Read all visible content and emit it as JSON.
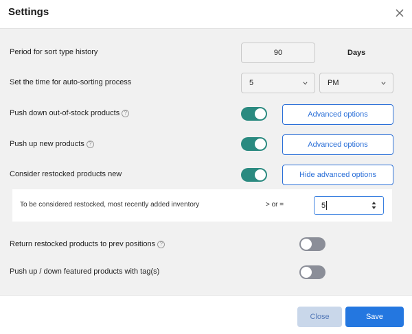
{
  "dialog": {
    "title": "Settings",
    "close_icon": "close-icon"
  },
  "settings": {
    "sort_history": {
      "label": "Period for sort type history",
      "value": "90",
      "unit": "Days"
    },
    "auto_sort_time": {
      "label": "Set the time for auto-sorting process",
      "hour": "5",
      "period": "PM"
    },
    "push_down_oos": {
      "label": "Push down out-of-stock products",
      "help_icon": "question-icon",
      "enabled": true,
      "button_label": "Advanced options"
    },
    "push_up_new": {
      "label": "Push up new products",
      "help_icon": "question-icon",
      "enabled": true,
      "button_label": "Advanced options"
    },
    "restocked_new": {
      "label": "Consider restocked products new",
      "enabled": true,
      "button_label": "Hide advanced options",
      "advanced": {
        "label": "To be considered restocked, most recently added inventory",
        "operator": "> or =",
        "value": "5"
      }
    },
    "return_restocked": {
      "label": "Return restocked products to prev positions",
      "help_icon": "question-icon",
      "enabled": false
    },
    "featured_tags": {
      "label": "Push up / down featured products with tag(s)",
      "enabled": false
    }
  },
  "footer": {
    "close_label": "Close",
    "save_label": "Save"
  },
  "colors": {
    "toggle_on": "#2b8a80",
    "toggle_off": "#8b8e98",
    "accent": "#2477e0",
    "outline_button": "#2a6fd8"
  }
}
